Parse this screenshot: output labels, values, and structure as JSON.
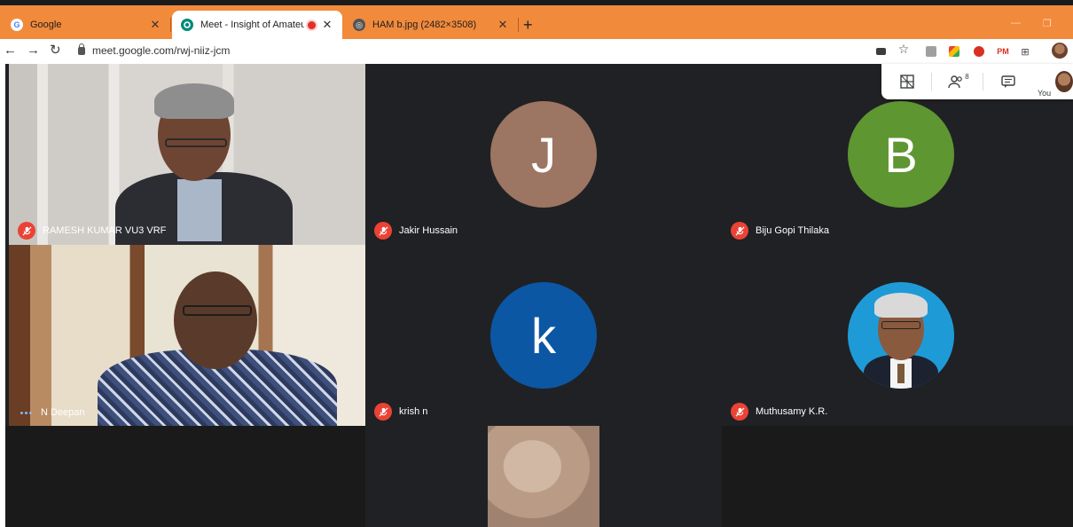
{
  "browser": {
    "tabs": [
      {
        "title": "Google",
        "active": false,
        "favicon": "google-icon"
      },
      {
        "title": "Meet - Insight of Amateur Ra",
        "active": true,
        "favicon": "meet-icon",
        "recording": true
      },
      {
        "title": "HAM b.jpg (2482×3508)",
        "active": false,
        "favicon": "globe-icon"
      }
    ],
    "new_tab": "+",
    "url": "meet.google.com/rwj-niiz-jcm",
    "extensions": [
      "camera-icon",
      "star-icon",
      "pdf-icon",
      "colorful-ext-icon",
      "shield-ext-icon",
      "PM",
      "grid-ext-icon"
    ],
    "colors": {
      "tabbar": "#f28a3c",
      "meet_bg": "#202124",
      "mute_red": "#ea4335"
    }
  },
  "meet": {
    "controls": {
      "people_count": "8",
      "you_label": "You"
    },
    "participants": [
      {
        "name": "RAMESH KUMAR VU3 VRF",
        "muted": true,
        "video": true
      },
      {
        "name": "Jakir Hussain",
        "muted": true,
        "initial": "J",
        "color": "#9c7563"
      },
      {
        "name": "Biju Gopi Thilaka",
        "muted": true,
        "initial": "B",
        "color": "#5e9632"
      },
      {
        "name": "N Deepan",
        "muted": false,
        "video": true
      },
      {
        "name": "krish n",
        "muted": true,
        "initial": "k",
        "color": "#0b57a4"
      },
      {
        "name": "Muthusamy K.R.",
        "muted": true,
        "photo": true
      }
    ]
  }
}
